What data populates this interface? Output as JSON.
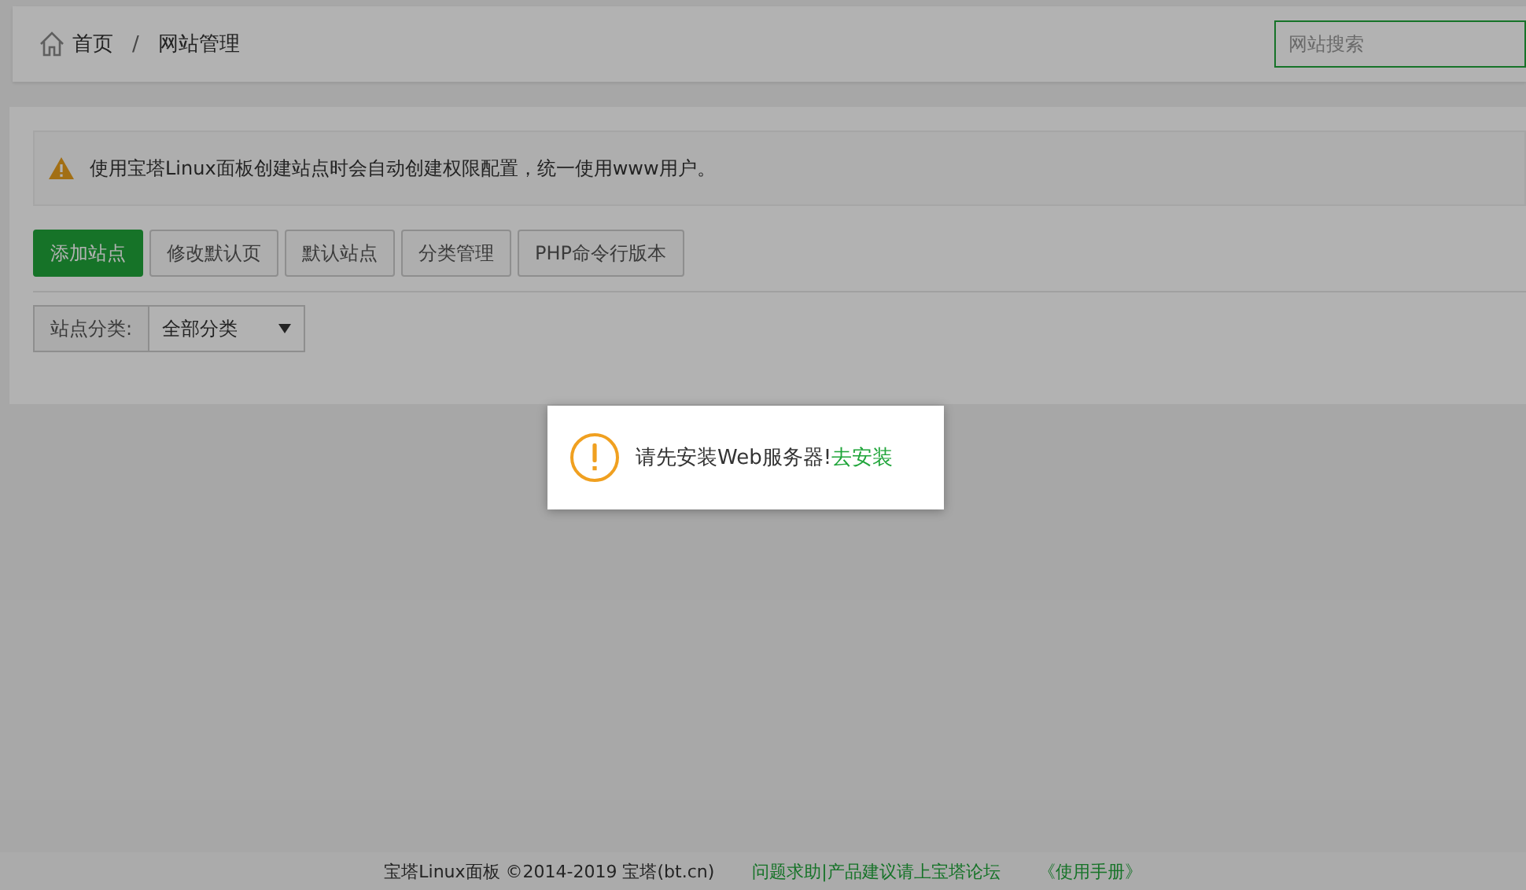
{
  "breadcrumb": [
    {
      "label": "首页",
      "kind": "home"
    },
    {
      "label": "网站管理",
      "kind": "page"
    }
  ],
  "breadcrumb_separator": "/",
  "search": {
    "placeholder": "网站搜索"
  },
  "notice": {
    "text": "使用宝塔Linux面板创建站点时会自动创建权限配置，统一使用www用户。"
  },
  "buttons": [
    {
      "label": "添加站点",
      "primary": true
    },
    {
      "label": "修改默认页",
      "primary": false
    },
    {
      "label": "默认站点",
      "primary": false
    },
    {
      "label": "分类管理",
      "primary": false
    },
    {
      "label": "PHP命令行版本",
      "primary": false
    }
  ],
  "category_filter": {
    "label": "站点分类:",
    "value": "全部分类"
  },
  "dialog": {
    "message": "请先安装Web服务器!",
    "link": "去安装"
  },
  "footer": {
    "copyright": "宝塔Linux面板 ©2014-2019 宝塔(bt.cn)",
    "forum_link": "问题求助|产品建议请上宝塔论坛",
    "manual_link": "《使用手册》"
  }
}
